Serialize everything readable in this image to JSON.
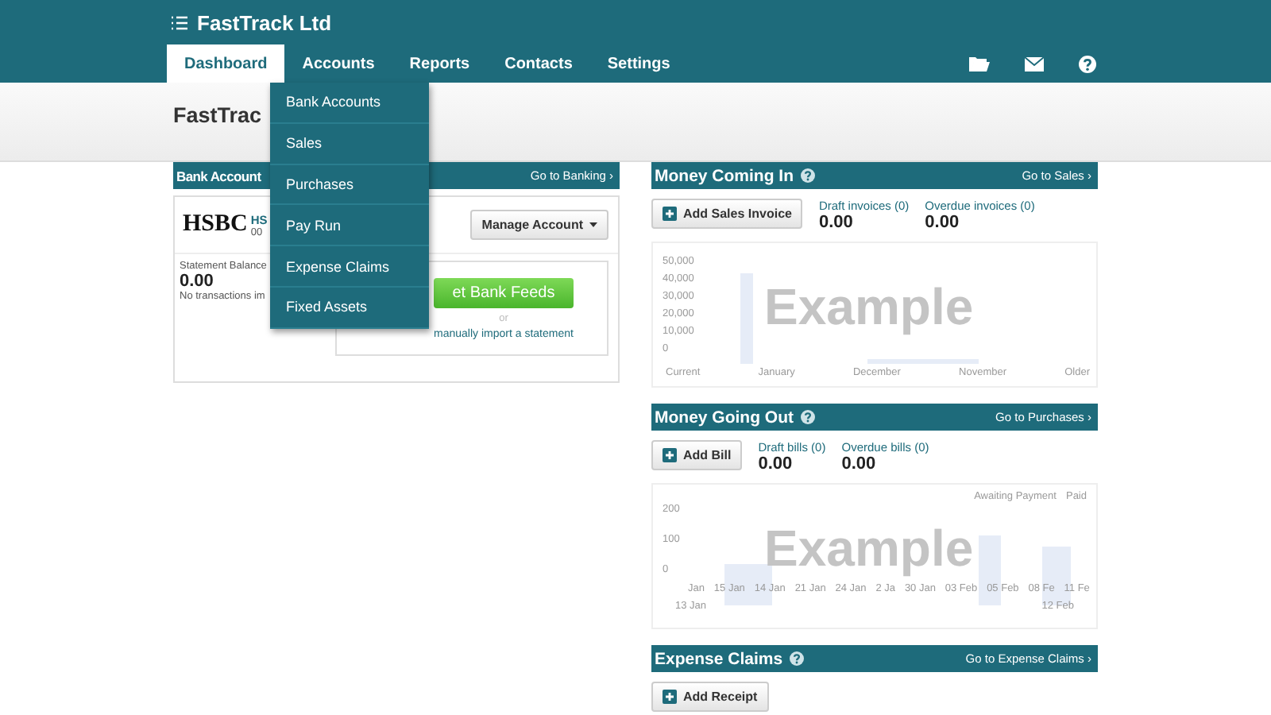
{
  "app": {
    "title": "FastTrack Ltd"
  },
  "nav": [
    {
      "label": "Dashboard",
      "selected": true
    },
    {
      "label": "Accounts",
      "selected": false
    },
    {
      "label": "Reports",
      "selected": false
    },
    {
      "label": "Contacts",
      "selected": false
    },
    {
      "label": "Settings",
      "selected": false
    }
  ],
  "menu": {
    "items": [
      "Bank Accounts",
      "Sales",
      "Purchases",
      "Pay Run",
      "Expense Claims",
      "Fixed Assets"
    ]
  },
  "page_title": "FastTrac",
  "bank": {
    "title": "Bank Account",
    "link": "Go to Banking ›",
    "bank_logo": "HSBC",
    "account_name": "HS",
    "account_number": "00",
    "manage": "Manage Account",
    "balance_label": "Statement Balance",
    "balance": "0.00",
    "note": "No transactions im",
    "feeds_button": "et Bank Feeds",
    "or": "or",
    "import_link": "manually import a statement"
  },
  "panels": [
    {
      "title": "Money Coming In",
      "link": "Go to Sales ›",
      "button": "Add Sales Invoice",
      "stats": [
        {
          "label": "Draft invoices (0)",
          "value": "0.00"
        },
        {
          "label": "Overdue invoices (0)",
          "value": "0.00"
        }
      ],
      "chart": {
        "kind": "columns",
        "overlay": "Example",
        "y_labels": [
          "50,000",
          "40,000",
          "30,000",
          "20,000",
          "10,000",
          "0"
        ],
        "x_labels": [
          "Current",
          "January",
          "December",
          "November",
          "Older"
        ]
      }
    },
    {
      "title": "Money Going Out",
      "link": "Go to Purchases ›",
      "button": "Add Bill",
      "stats": [
        {
          "label": "Draft bills (0)",
          "value": "0.00"
        },
        {
          "label": "Overdue bills (0)",
          "value": "0.00"
        }
      ],
      "chart": {
        "kind": "timeline",
        "overlay": "Example",
        "legend": [
          "Awaiting Payment",
          "Paid"
        ],
        "y_labels": [
          "200",
          "100",
          "0"
        ],
        "x_labels": [
          "Jan",
          "15 Jan",
          "14 Jan",
          "21 Jan",
          "24 Jan",
          "2 Ja",
          "30 Jan",
          "03 Feb",
          "05 Feb",
          "08 Fe",
          "11 Fe"
        ],
        "range_labels": [
          "13 Jan",
          "12 Feb"
        ]
      }
    },
    {
      "title": "Expense Claims",
      "link": "Go to Expense Claims ›",
      "button": "Add Receipt"
    }
  ]
}
